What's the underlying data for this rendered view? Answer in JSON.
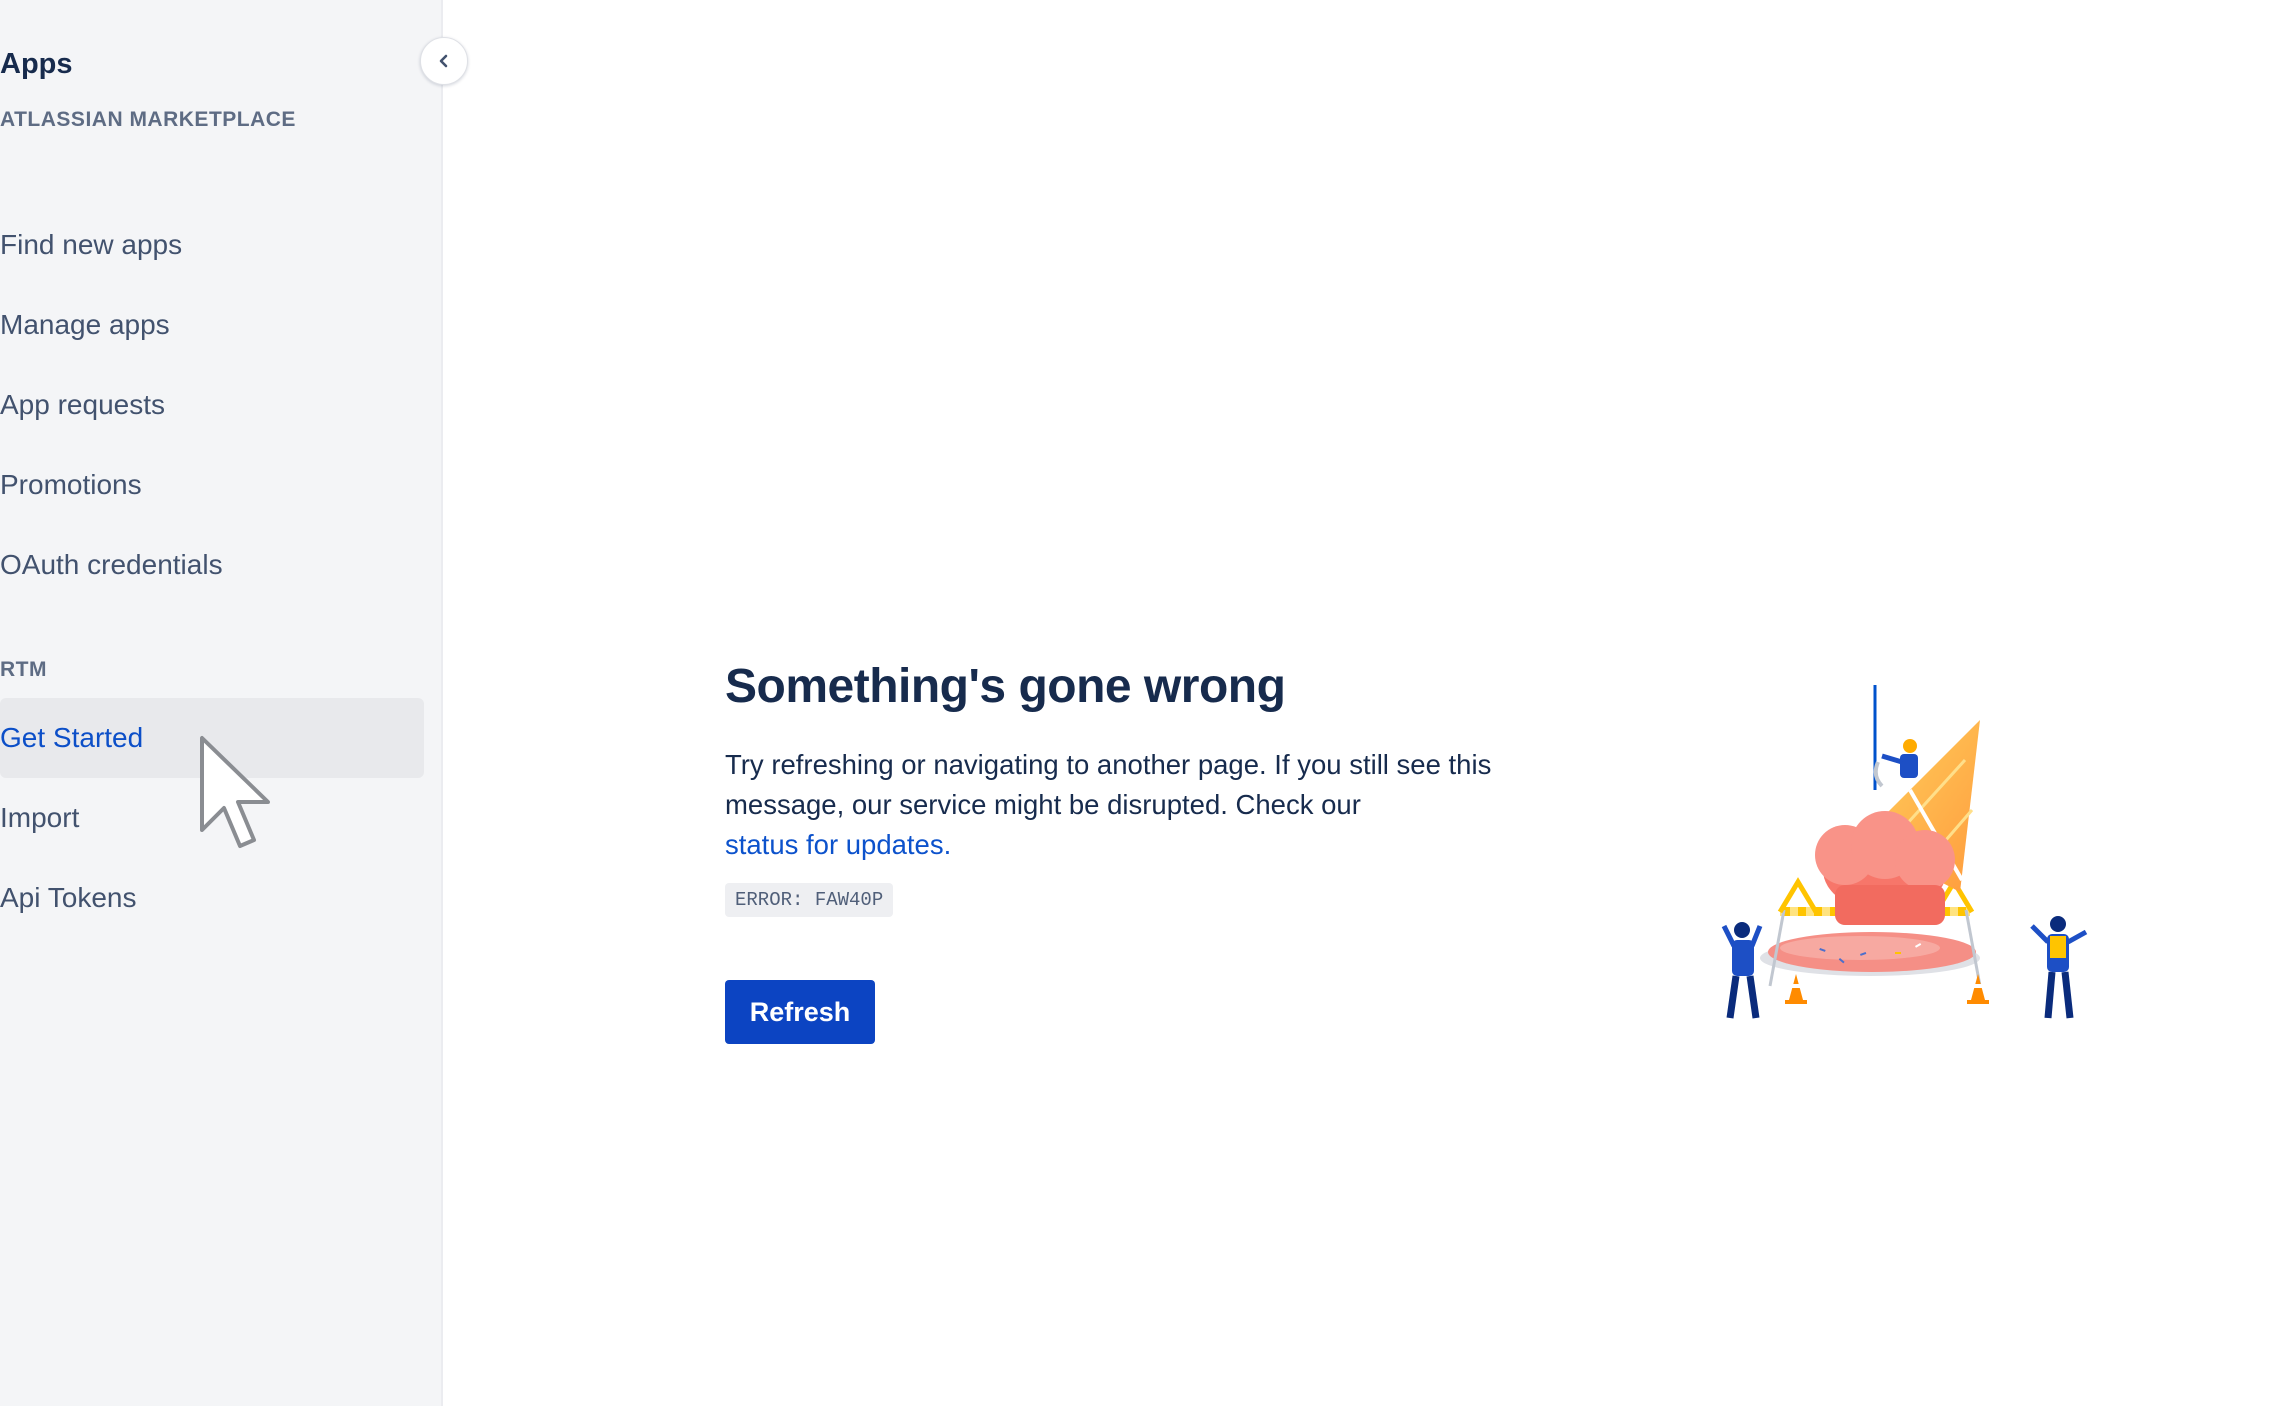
{
  "sidebar": {
    "title": "Apps",
    "collapse_icon": "chevron-left-icon",
    "sections": [
      {
        "label": "ATLASSIAN MARKETPLACE",
        "items": [
          {
            "label": "Find new apps"
          },
          {
            "label": "Manage apps"
          },
          {
            "label": "App requests"
          },
          {
            "label": "Promotions"
          },
          {
            "label": "OAuth credentials"
          }
        ]
      },
      {
        "label": "RTM",
        "items": [
          {
            "label": "Get Started",
            "active": true
          },
          {
            "label": "Import"
          },
          {
            "label": "Api Tokens"
          }
        ]
      }
    ]
  },
  "error": {
    "title": "Something's gone wrong",
    "message": "Try refreshing or navigating to another page. If you still see this message, our service might be disrupted. Check our",
    "link_text": "status for updates.",
    "code": "ERROR: FAW40P",
    "refresh_label": "Refresh",
    "illustration": "melted-ice-cream-construction-illustration"
  },
  "colors": {
    "sidebar_bg": "#f4f5f7",
    "active_item_bg": "#e8e9ec",
    "active_item_text": "#0c4fc8",
    "primary_button": "#0c44c2",
    "link": "#0c52cc",
    "heading": "#172b4d"
  },
  "cursor": "arrow-cursor-icon"
}
